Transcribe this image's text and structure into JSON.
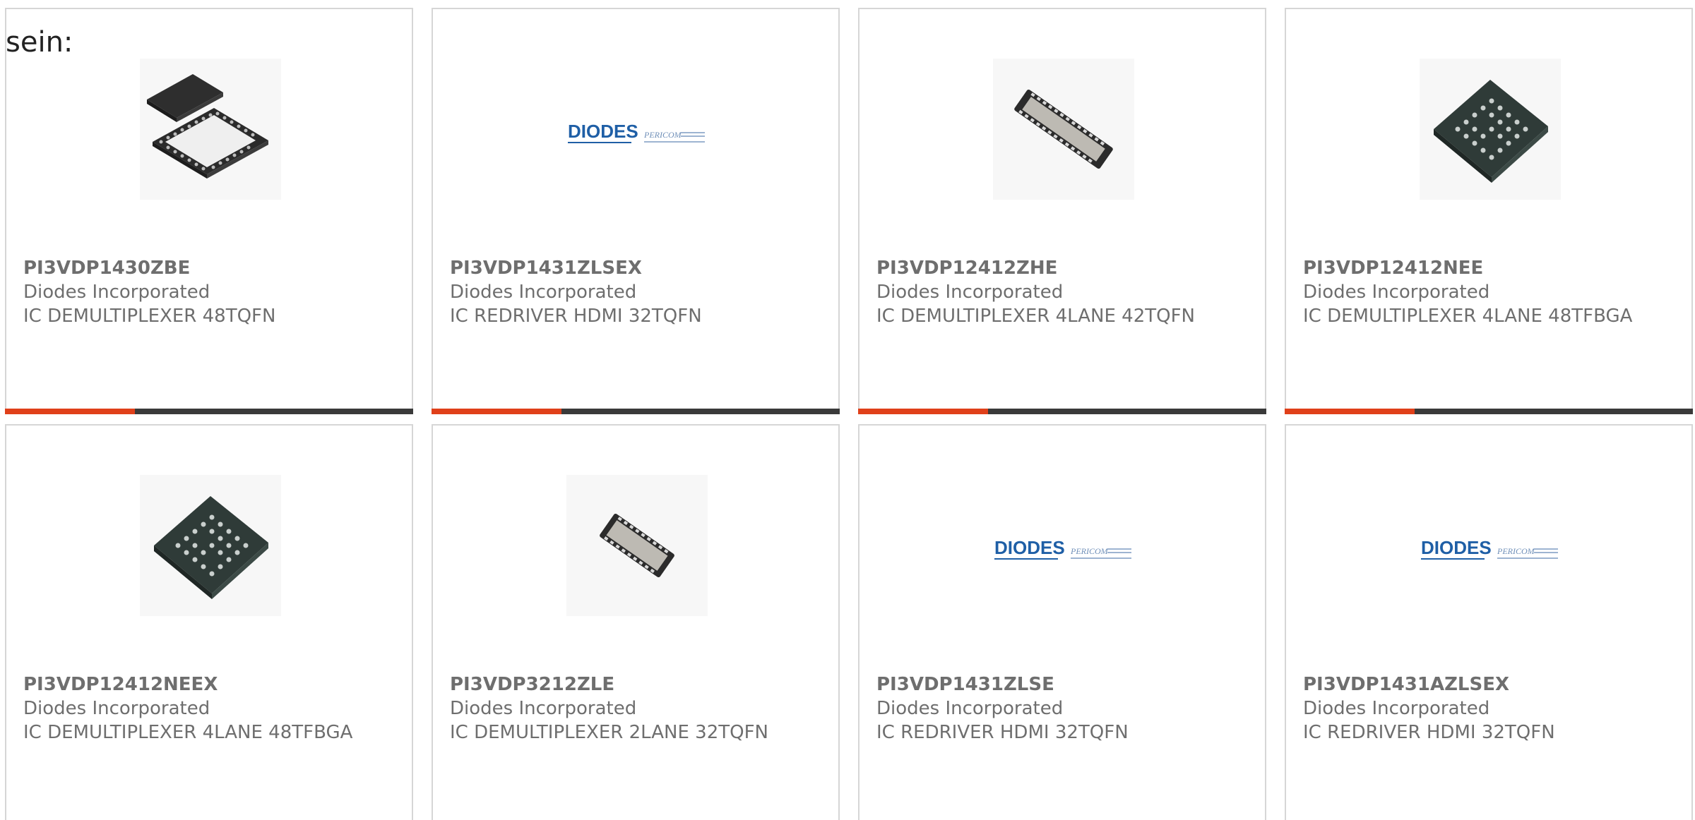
{
  "lead_text": "sein:",
  "products": [
    {
      "part_number": "PI3VDP1430ZBE",
      "manufacturer": "Diodes Incorporated",
      "description": "IC DEMULTIPLEXER 48TQFN",
      "image": "tqfn-package-icon"
    },
    {
      "part_number": "PI3VDP1431ZLSEX",
      "manufacturer": "Diodes Incorporated",
      "description": "IC REDRIVER HDMI 32TQFN",
      "image": "diodes-pericom-logo"
    },
    {
      "part_number": "PI3VDP12412ZHE",
      "manufacturer": "Diodes Incorporated",
      "description": "IC DEMULTIPLEXER 4LANE 42TQFN",
      "image": "tqfn-strip-package-icon"
    },
    {
      "part_number": "PI3VDP12412NEE",
      "manufacturer": "Diodes Incorporated",
      "description": "IC DEMULTIPLEXER 4LANE 48TFBGA",
      "image": "bga-package-icon"
    },
    {
      "part_number": "PI3VDP12412NEEX",
      "manufacturer": "Diodes Incorporated",
      "description": "IC DEMULTIPLEXER 4LANE 48TFBGA",
      "image": "bga-package-icon"
    },
    {
      "part_number": "PI3VDP3212ZLE",
      "manufacturer": "Diodes Incorporated",
      "description": "IC DEMULTIPLEXER 2LANE 32TQFN",
      "image": "tqfn-strip-package-icon"
    },
    {
      "part_number": "PI3VDP1431ZLSE",
      "manufacturer": "Diodes Incorporated",
      "description": "IC REDRIVER HDMI 32TQFN",
      "image": "diodes-pericom-logo"
    },
    {
      "part_number": "PI3VDP1431AZLSEX",
      "manufacturer": "Diodes Incorporated",
      "description": "IC REDRIVER HDMI 32TQFN",
      "image": "diodes-pericom-logo"
    }
  ],
  "logo": {
    "brand": "DIODES",
    "sub_brand": "PERICOM"
  },
  "colors": {
    "accent": "#e0401a",
    "bar": "#3a3a3a",
    "text": "#6e6e6e",
    "border": "#d6d6d6",
    "diodes_blue": "#1f5fa6"
  }
}
